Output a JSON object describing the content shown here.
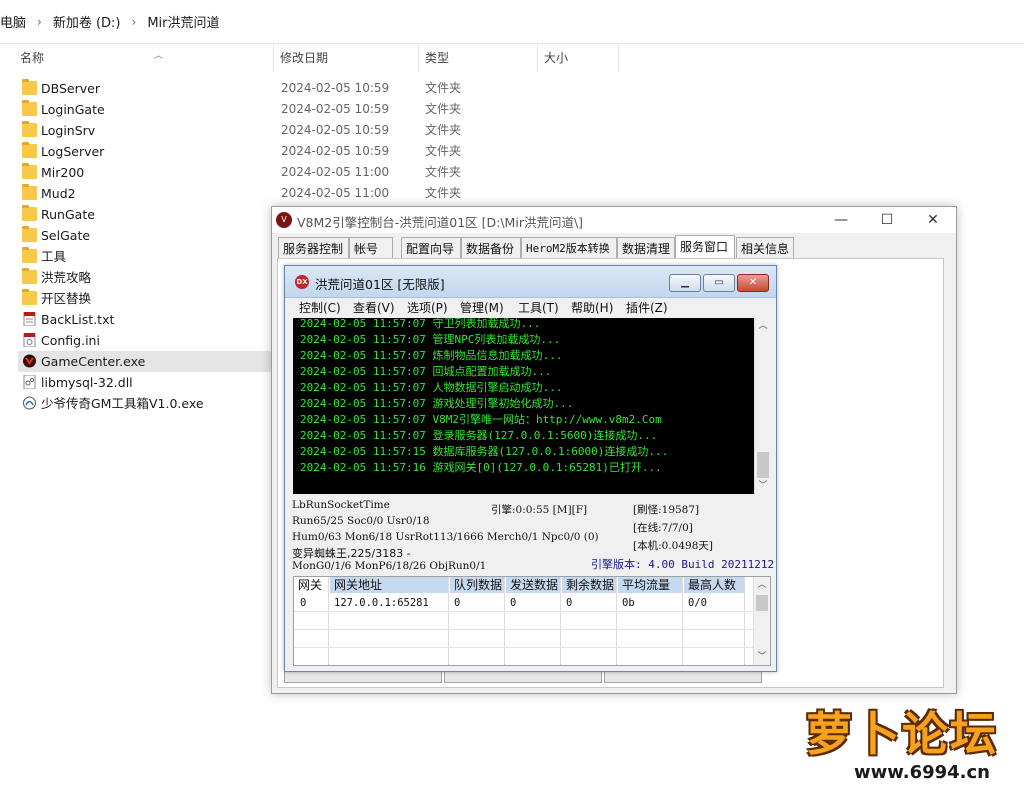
{
  "breadcrumb": [
    "电脑",
    "新加卷 (D:)",
    "Mir洪荒问道"
  ],
  "columns": {
    "name": "名称",
    "date": "修改日期",
    "type": "类型",
    "size": "大小"
  },
  "files": [
    {
      "name": "DBServer",
      "date": "2024-02-05 10:59",
      "type": "文件夹",
      "icon": "folder-icon"
    },
    {
      "name": "LoginGate",
      "date": "2024-02-05 10:59",
      "type": "文件夹",
      "icon": "folder-icon"
    },
    {
      "name": "LoginSrv",
      "date": "2024-02-05 10:59",
      "type": "文件夹",
      "icon": "folder-icon"
    },
    {
      "name": "LogServer",
      "date": "2024-02-05 10:59",
      "type": "文件夹",
      "icon": "folder-icon"
    },
    {
      "name": "Mir200",
      "date": "2024-02-05 11:00",
      "type": "文件夹",
      "icon": "folder-icon"
    },
    {
      "name": "Mud2",
      "date": "2024-02-05 11:00",
      "type": "文件夹",
      "icon": "folder-icon"
    },
    {
      "name": "RunGate",
      "date": "",
      "type": "",
      "icon": "folder-icon"
    },
    {
      "name": "SelGate",
      "date": "",
      "type": "",
      "icon": "folder-icon"
    },
    {
      "name": "工具",
      "date": "",
      "type": "",
      "icon": "folder-icon"
    },
    {
      "name": "洪荒攻略",
      "date": "",
      "type": "",
      "icon": "folder-icon"
    },
    {
      "name": "开区替换",
      "date": "",
      "type": "",
      "icon": "folder-icon"
    },
    {
      "name": "BackList.txt",
      "date": "",
      "type": "",
      "icon": "text-file-icon"
    },
    {
      "name": "Config.ini",
      "date": "",
      "type": "",
      "icon": "ini-file-icon"
    },
    {
      "name": "GameCenter.exe",
      "date": "",
      "type": "",
      "icon": "gamecenter-app-icon"
    },
    {
      "name": "libmysql-32.dll",
      "date": "",
      "type": "",
      "icon": "dll-file-icon"
    },
    {
      "name": "少爷传奇GM工具箱V1.0.exe",
      "date": "",
      "type": "",
      "icon": "exe-app-icon"
    }
  ],
  "console": {
    "title": "V8M2引擎控制台-洪荒问道01区 [D:\\Mir洪荒问道\\]",
    "minimize": "—",
    "maximize": "☐",
    "close": "✕",
    "tabs": [
      "服务器控制",
      "帐号",
      "配置向导",
      "数据备份",
      "HeroM2版本转换",
      "数据清理",
      "服务窗口",
      "相关信息"
    ],
    "active_tab": "服务窗口"
  },
  "server": {
    "title": "洪荒问道01区 [无限版]",
    "menu": [
      "控制(C)",
      "查看(V)",
      "选项(P)",
      "管理(M)",
      "工具(T)",
      "帮助(H)",
      "插件(Z)"
    ],
    "log": [
      "2024-02-05 11:57:07 守卫列表加载成功...",
      "2024-02-05 11:57:07 管理NPC列表加载成功...",
      "2024-02-05 11:57:07 炼制物品信息加载成功...",
      "2024-02-05 11:57:07 回城点配置加载成功...",
      "2024-02-05 11:57:07 人物数据引擎启动成功...",
      "2024-02-05 11:57:07 游戏处理引擎初始化成功...",
      "2024-02-05 11:57:07 V8M2引擎唯一网站：http://www.v8m2.Com",
      "2024-02-05 11:57:07 登录服务器(127.0.0.1:5600)连接成功...",
      "2024-02-05 11:57:15 数据库服务器(127.0.0.1:6000)连接成功...",
      "2024-02-05 11:57:16 游戏网关[0](127.0.0.1:65281)已打开..."
    ],
    "stats": {
      "s1": "LbRunSocketTime",
      "s2": "Run65/25 Soc0/0 Usr0/18",
      "s3": "Hum0/63 Mon6/18 UsrRot113/1666 Merch0/1 Npc0/0 (0)",
      "s4": "变异蜘蛛王,225/3183 -",
      "s5": "MonG0/1/6 MonP6/18/26 ObjRun0/1",
      "engine": "引擎:0:0:55 [M][F]",
      "refresh": "[刷怪:19587]",
      "online": "[在线:7/7/0]",
      "local": "[本机:0.0498天]",
      "version": "引擎版本: 4.00 Build 20211212"
    },
    "grid": {
      "headers": [
        "网关",
        "网关地址",
        "队列数据",
        "发送数据",
        "剩余数据",
        "平均流量",
        "最高人数"
      ],
      "row": [
        "0",
        "127.0.0.1:65281",
        "0",
        "0",
        "0",
        "0b",
        "0/0"
      ]
    }
  },
  "watermark": {
    "text": "萝卜论坛",
    "url": "www.6994.cn"
  }
}
